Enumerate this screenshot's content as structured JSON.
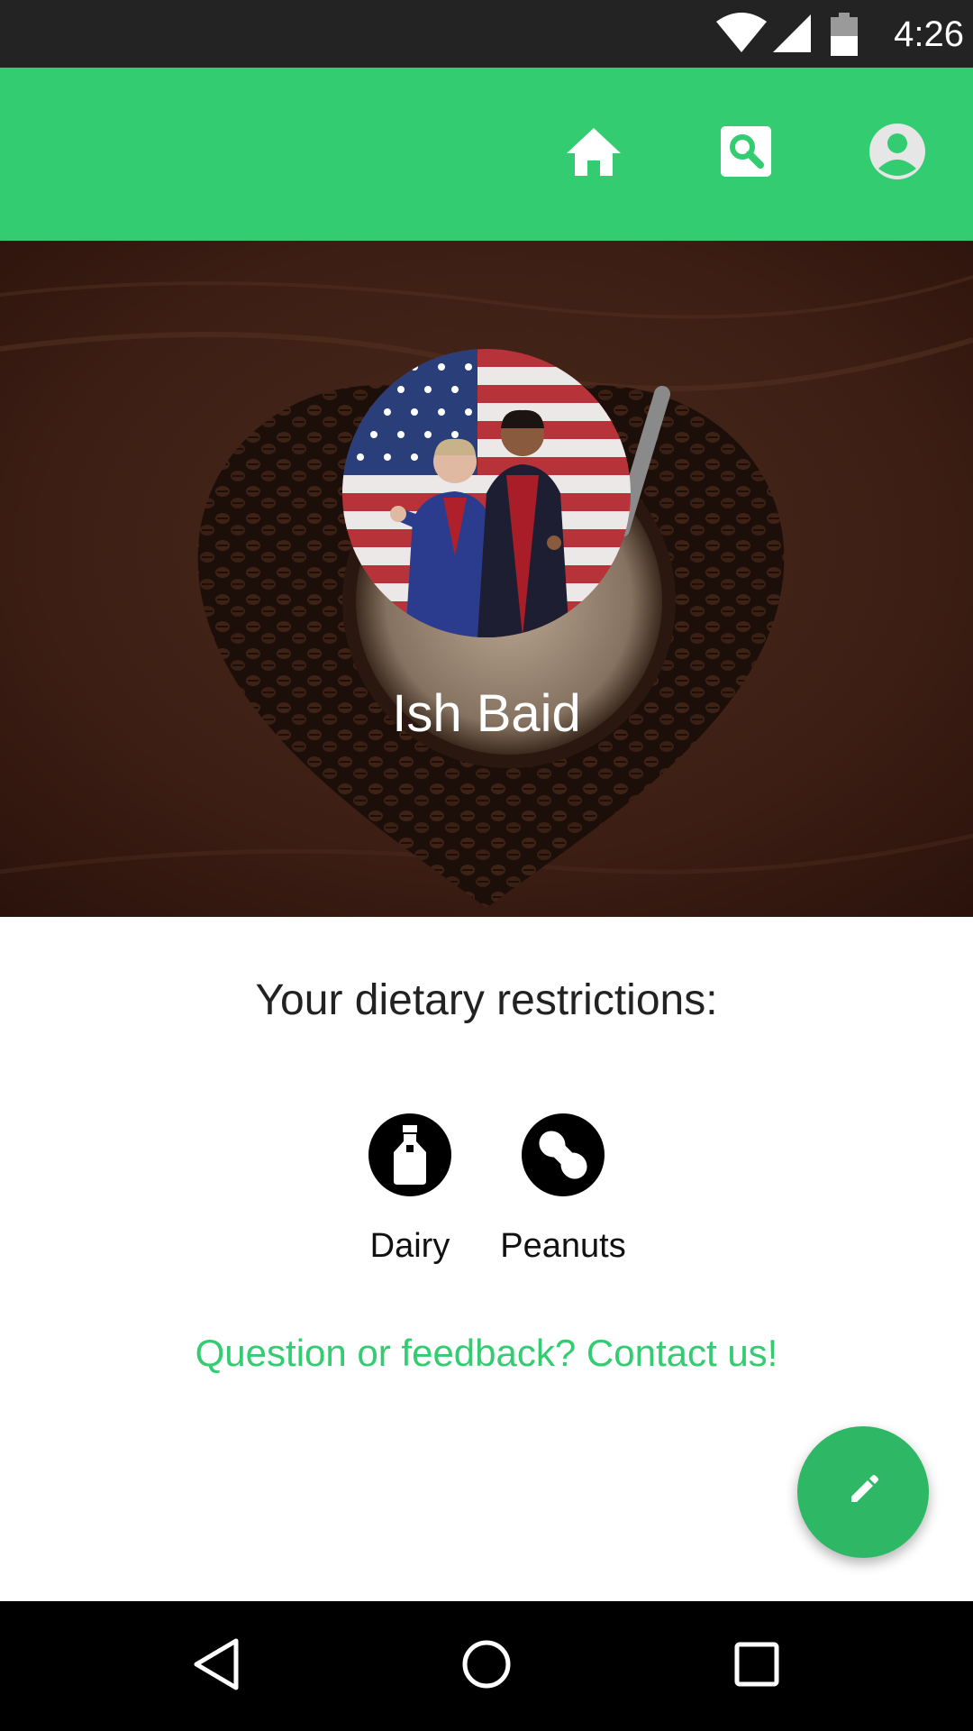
{
  "status_bar": {
    "time": "4:26",
    "icons": [
      "wifi-icon",
      "signal-icon",
      "battery-icon"
    ]
  },
  "app_bar": {
    "background_color": "#33cc71",
    "actions": [
      {
        "name": "home",
        "icon": "home-icon"
      },
      {
        "name": "search",
        "icon": "search-icon"
      },
      {
        "name": "profile",
        "icon": "account-circle-icon"
      }
    ]
  },
  "profile": {
    "name": "Ish Baid",
    "avatar_icon": "profile-photo"
  },
  "dietary": {
    "title": "Your dietary restrictions:",
    "items": [
      {
        "label": "Dairy",
        "icon": "milk-bottle-icon"
      },
      {
        "label": "Peanuts",
        "icon": "peanut-icon"
      }
    ]
  },
  "contact": {
    "text": "Question or feedback? Contact us!",
    "color": "#33cc71"
  },
  "fab": {
    "icon": "edit-pencil-icon",
    "color": "#2eb866"
  },
  "system_nav": {
    "buttons": [
      "back-icon",
      "home-circle-icon",
      "recents-icon"
    ]
  }
}
